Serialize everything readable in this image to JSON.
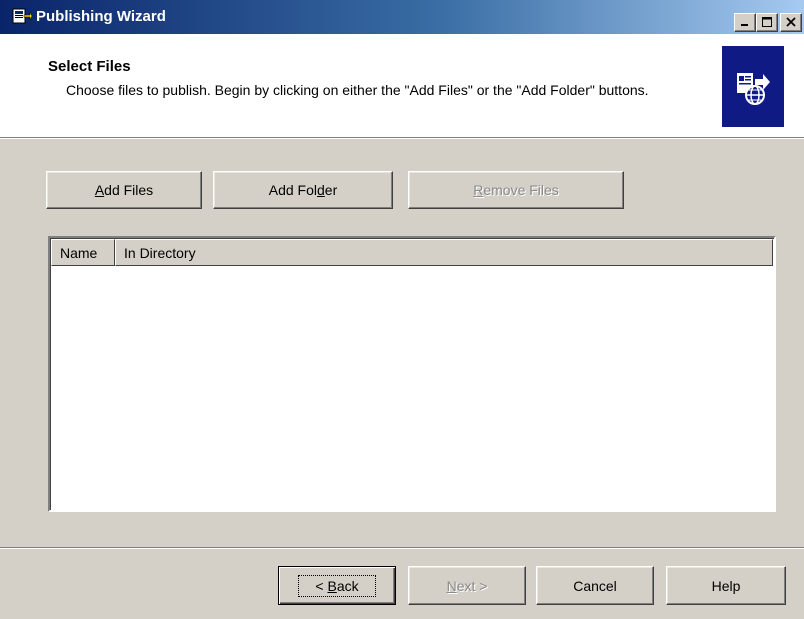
{
  "window": {
    "title": "Publishing Wizard",
    "minimize_icon": "minimize-icon",
    "maximize_icon": "maximize-icon",
    "close_icon": "close-icon"
  },
  "header": {
    "title": "Select Files",
    "description": "Choose files to publish.  Begin by clicking on either the \"Add Files\" or the \"Add Folder\" buttons.",
    "icon": "publish-web-icon",
    "icon_bg": "#0f1a85"
  },
  "actions": {
    "add_files": {
      "pre": "",
      "key": "A",
      "post": "dd Files"
    },
    "add_folder": {
      "pre": "Add Fol",
      "key": "d",
      "post": "er"
    },
    "remove_files": {
      "pre": "",
      "key": "R",
      "post": "emove Files",
      "enabled": false
    }
  },
  "file_list": {
    "columns": [
      "Name",
      "In Directory"
    ],
    "rows": []
  },
  "footer": {
    "back": {
      "pre": "< ",
      "key": "B",
      "post": "ack"
    },
    "next": {
      "pre": "",
      "key": "N",
      "post": "ext >",
      "enabled": false
    },
    "cancel": "Cancel",
    "help": "Help"
  },
  "colors": {
    "titlebar_start": "#0a246a",
    "titlebar_end": "#a6caf0",
    "face": "#d4d0c8"
  }
}
